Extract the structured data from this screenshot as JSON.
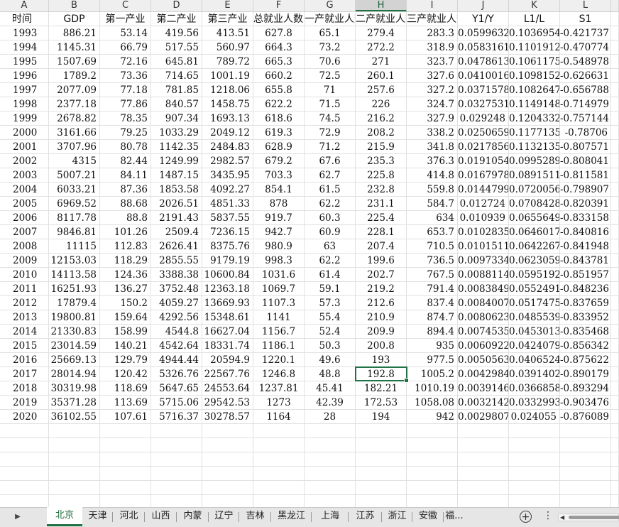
{
  "column_letters": [
    "A",
    "B",
    "C",
    "D",
    "E",
    "F",
    "G",
    "H",
    "I",
    "J",
    "K",
    "L"
  ],
  "selected_column": "H",
  "headers": [
    "时间",
    "GDP",
    "第一产业",
    "第二产业",
    "第三产业",
    "总就业人数",
    "一产就业人数",
    "二产就业人数",
    "三产就业人数",
    "Y1/Y",
    "L1/L",
    "S1"
  ],
  "rows": [
    [
      "1993",
      "886.21",
      "53.14",
      "419.56",
      "413.51",
      "627.8",
      "65.1",
      "279.4",
      "283.3",
      "0.0599632",
      "0.1036954",
      "-0.421737"
    ],
    [
      "1994",
      "1145.31",
      "66.79",
      "517.55",
      "560.97",
      "664.3",
      "73.2",
      "272.2",
      "318.9",
      "0.0583161",
      "0.1101912",
      "-0.470774"
    ],
    [
      "1995",
      "1507.69",
      "72.16",
      "645.81",
      "789.72",
      "665.3",
      "70.6",
      "271",
      "323.7",
      "0.0478613",
      "0.1061175",
      "-0.548978"
    ],
    [
      "1996",
      "1789.2",
      "73.36",
      "714.65",
      "1001.19",
      "660.2",
      "72.5",
      "260.1",
      "327.6",
      "0.0410016",
      "0.1098152",
      "-0.626631"
    ],
    [
      "1997",
      "2077.09",
      "77.18",
      "781.85",
      "1218.06",
      "655.8",
      "71",
      "257.6",
      "327.2",
      "0.0371578",
      "0.1082647",
      "-0.656788"
    ],
    [
      "1998",
      "2377.18",
      "77.86",
      "840.57",
      "1458.75",
      "622.2",
      "71.5",
      "226",
      "324.7",
      "0.0327531",
      "0.1149148",
      "-0.714979"
    ],
    [
      "1999",
      "2678.82",
      "78.35",
      "907.34",
      "1693.13",
      "618.6",
      "74.5",
      "216.2",
      "327.9",
      "0.029248",
      "0.1204332",
      "-0.757144"
    ],
    [
      "2000",
      "3161.66",
      "79.25",
      "1033.29",
      "2049.12",
      "619.3",
      "72.9",
      "208.2",
      "338.2",
      "0.0250659",
      "0.1177135",
      "-0.78706"
    ],
    [
      "2001",
      "3707.96",
      "80.78",
      "1142.35",
      "2484.83",
      "628.9",
      "71.2",
      "215.9",
      "341.8",
      "0.0217856",
      "0.1132135",
      "-0.807571"
    ],
    [
      "2002",
      "4315",
      "82.44",
      "1249.99",
      "2982.57",
      "679.2",
      "67.6",
      "235.3",
      "376.3",
      "0.0191054",
      "0.0995289",
      "-0.808041"
    ],
    [
      "2003",
      "5007.21",
      "84.11",
      "1487.15",
      "3435.95",
      "703.3",
      "62.7",
      "225.8",
      "414.8",
      "0.0167978",
      "0.0891511",
      "-0.811581"
    ],
    [
      "2004",
      "6033.21",
      "87.36",
      "1853.58",
      "4092.27",
      "854.1",
      "61.5",
      "232.8",
      "559.8",
      "0.0144799",
      "0.0720056",
      "-0.798907"
    ],
    [
      "2005",
      "6969.52",
      "88.68",
      "2026.51",
      "4851.33",
      "878",
      "62.2",
      "231.1",
      "584.7",
      "0.012724",
      "0.0708428",
      "-0.820391"
    ],
    [
      "2006",
      "8117.78",
      "88.8",
      "2191.43",
      "5837.55",
      "919.7",
      "60.3",
      "225.4",
      "634",
      "0.010939",
      "0.0655649",
      "-0.833158"
    ],
    [
      "2007",
      "9846.81",
      "101.26",
      "2509.4",
      "7236.15",
      "942.7",
      "60.9",
      "228.1",
      "653.7",
      "0.0102835",
      "0.0646017",
      "-0.840816"
    ],
    [
      "2008",
      "11115",
      "112.83",
      "2626.41",
      "8375.76",
      "980.9",
      "63",
      "207.4",
      "710.5",
      "0.0101511",
      "0.0642267",
      "-0.841948"
    ],
    [
      "2009",
      "12153.03",
      "118.29",
      "2855.55",
      "9179.19",
      "998.3",
      "62.2",
      "199.6",
      "736.5",
      "0.0097334",
      "0.0623059",
      "-0.843781"
    ],
    [
      "2010",
      "14113.58",
      "124.36",
      "3388.38",
      "10600.84",
      "1031.6",
      "61.4",
      "202.7",
      "767.5",
      "0.0088114",
      "0.0595192",
      "-0.851957"
    ],
    [
      "2011",
      "16251.93",
      "136.27",
      "3752.48",
      "12363.18",
      "1069.7",
      "59.1",
      "219.2",
      "791.4",
      "0.0083849",
      "0.0552491",
      "-0.848236"
    ],
    [
      "2012",
      "17879.4",
      "150.2",
      "4059.27",
      "13669.93",
      "1107.3",
      "57.3",
      "212.6",
      "837.4",
      "0.0084007",
      "0.0517475",
      "-0.837659"
    ],
    [
      "2013",
      "19800.81",
      "159.64",
      "4292.56",
      "15348.61",
      "1141",
      "55.4",
      "210.9",
      "874.7",
      "0.0080623",
      "0.0485539",
      "-0.833952"
    ],
    [
      "2014",
      "21330.83",
      "158.99",
      "4544.8",
      "16627.04",
      "1156.7",
      "52.4",
      "209.9",
      "894.4",
      "0.0074535",
      "0.0453013",
      "-0.835468"
    ],
    [
      "2015",
      "23014.59",
      "140.21",
      "4542.64",
      "18331.74",
      "1186.1",
      "50.3",
      "200.8",
      "935",
      "0.0060922",
      "0.0424079",
      "-0.856342"
    ],
    [
      "2016",
      "25669.13",
      "129.79",
      "4944.44",
      "20594.9",
      "1220.1",
      "49.6",
      "193",
      "977.5",
      "0.0050563",
      "0.0406524",
      "-0.875622"
    ],
    [
      "2017",
      "28014.94",
      "120.42",
      "5326.76",
      "22567.76",
      "1246.8",
      "48.8",
      "192.8",
      "1005.2",
      "0.0042984",
      "0.0391402",
      "-0.890179"
    ],
    [
      "2018",
      "30319.98",
      "118.69",
      "5647.65",
      "24553.64",
      "1237.81",
      "45.41",
      "182.21",
      "1010.19",
      "0.0039146",
      "0.0366858",
      "-0.893294"
    ],
    [
      "2019",
      "35371.28",
      "113.69",
      "5715.06",
      "29542.53",
      "1273",
      "42.39",
      "172.53",
      "1058.08",
      "0.0032142",
      "0.0332993",
      "-0.903476"
    ],
    [
      "2020",
      "36102.55",
      "107.61",
      "5716.37",
      "30278.57",
      "1164",
      "28",
      "194",
      "942",
      "0.0029807",
      "0.024055",
      "-0.876089"
    ]
  ],
  "active_cell": {
    "row_label": "2017",
    "column": "H",
    "value": "192.8"
  },
  "sheet_tabs": [
    "北京",
    "天津",
    "河北",
    "山西",
    "内蒙",
    "辽宁",
    "吉林",
    "黑龙江",
    "上海",
    "江苏",
    "浙江",
    "安徽",
    "福..."
  ],
  "active_tab": "北京",
  "icons": {
    "prev_sheet": "caret-right-icon",
    "add_sheet": "plus-circle-icon",
    "more": "vertical-ellipsis-icon",
    "scroll_left": "caret-left-icon"
  },
  "colors": {
    "accent": "#217346",
    "header_bg": "#efefef",
    "tabbar_bg": "#e6e6e6"
  }
}
